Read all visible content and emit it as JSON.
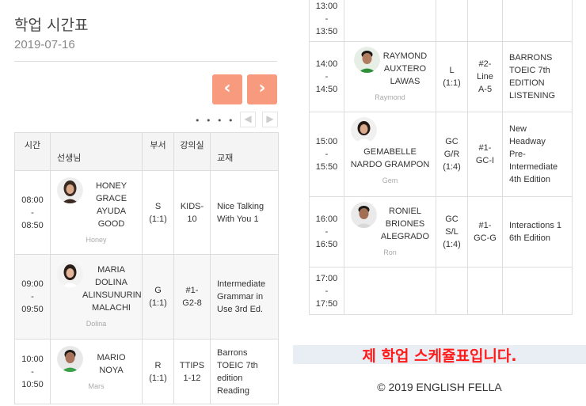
{
  "header": {
    "title": "학업 시간표",
    "date": "2019-07-16"
  },
  "nav": {
    "prev_icon": "‹",
    "next_icon": "›",
    "dots": "• • • • •",
    "mini_prev": "◀",
    "mini_next": "▶"
  },
  "table": {
    "headers": {
      "time": "시간",
      "teacher": "선생님",
      "dept": "부서",
      "room": "강의실",
      "book": "교재"
    },
    "rows": [
      {
        "start": "08:00",
        "sep": "-",
        "end": "08:50",
        "teacher": [
          "HONEY",
          "GRACE",
          "AYUDA",
          "GOOD"
        ],
        "nick": "Honey",
        "dept": [
          "S",
          "(1:1)"
        ],
        "room": [
          "KIDS-",
          "10"
        ],
        "book": [
          "Nice Talking",
          "With You 1"
        ]
      },
      {
        "start": "09:00",
        "sep": "-",
        "end": "09:50",
        "teacher": [
          "MARIA",
          "DOLINA",
          "ALINSUNURIN",
          "MALACHI"
        ],
        "nick": "Dolina",
        "dept": [
          "G",
          "(1:1)"
        ],
        "room": [
          "#1-",
          "G2-8"
        ],
        "book": [
          "Intermediate",
          "Grammar in",
          "Use 3rd Ed."
        ]
      },
      {
        "start": "10:00",
        "sep": "-",
        "end": "10:50",
        "teacher": [
          "MARIO",
          "NOYA"
        ],
        "nick": "Mars",
        "dept": [
          "R",
          "(1:1)"
        ],
        "room": [
          "TTIPS",
          "1-12"
        ],
        "book": [
          "Barrons",
          "TOEIC 7th",
          "edition",
          "Reading"
        ]
      },
      {
        "start": "13:00",
        "sep": "-",
        "end": "13:50",
        "teacher": [],
        "nick": "",
        "dept": [],
        "room": [],
        "book": []
      },
      {
        "start": "14:00",
        "sep": "-",
        "end": "14:50",
        "teacher": [
          "RAYMOND",
          "AUXTERO",
          "LAWAS"
        ],
        "nick": "Raymond",
        "dept": [
          "L",
          "(1:1)"
        ],
        "room": [
          "#2-",
          "Line",
          "A-5"
        ],
        "book": [
          "BARRONS",
          "TOEIC 7th",
          "EDITION",
          "LISTENING"
        ]
      },
      {
        "start": "15:00",
        "sep": "-",
        "end": "15:50",
        "teacher": [
          "GEMABELLE",
          "NARDO GRAMPON"
        ],
        "nick": "Gem",
        "dept": [
          "GC",
          "G/R",
          "(1:4)"
        ],
        "room": [
          "#1-",
          "GC-I"
        ],
        "book": [
          "New",
          "Headway",
          "Pre-",
          "Intermediate",
          "4th Edition"
        ]
      },
      {
        "start": "16:00",
        "sep": "-",
        "end": "16:50",
        "teacher": [
          "RONIEL",
          "BRIONES",
          "ALEGRADO"
        ],
        "nick": "Ron",
        "dept": [
          "GC",
          "S/L",
          "(1:4)"
        ],
        "room": [
          "#1-",
          "GC-G"
        ],
        "book": [
          "Interactions 1",
          "6th Edition"
        ]
      },
      {
        "start": "17:00",
        "sep": "-",
        "end": "17:50",
        "teacher": [],
        "nick": "",
        "dept": [],
        "room": [],
        "book": []
      }
    ]
  },
  "banner": "제 학업 스케쥴표입니다.",
  "footer": "© 2019 ENGLISH FELLA"
}
